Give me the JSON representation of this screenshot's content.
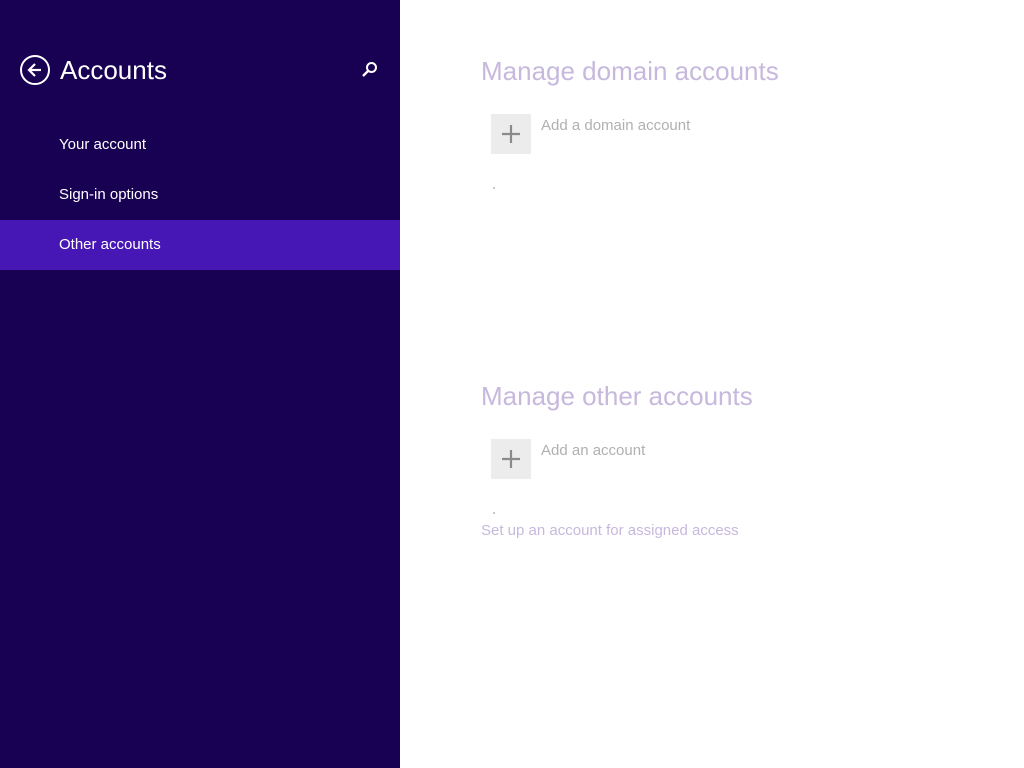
{
  "sidebar": {
    "title": "Accounts",
    "back_icon": "back-arrow-circle-icon",
    "search_icon": "search-icon",
    "items": [
      {
        "label": "Your account",
        "selected": false
      },
      {
        "label": "Sign-in options",
        "selected": false
      },
      {
        "label": "Other accounts",
        "selected": true
      }
    ]
  },
  "main": {
    "domain_section": {
      "title": "Manage domain accounts",
      "add_label": "Add a domain account",
      "add_icon": "plus-icon"
    },
    "other_section": {
      "title": "Manage other accounts",
      "add_label": "Add an account",
      "add_icon": "plus-icon",
      "assigned_access_link": "Set up an account for assigned access"
    }
  },
  "colors": {
    "sidebar_bg": "#180052",
    "selected_item_bg": "#4617b4",
    "heading_text": "#c7b8dd",
    "add_tile_bg": "#ececec",
    "muted_text": "#b0b0b0"
  }
}
